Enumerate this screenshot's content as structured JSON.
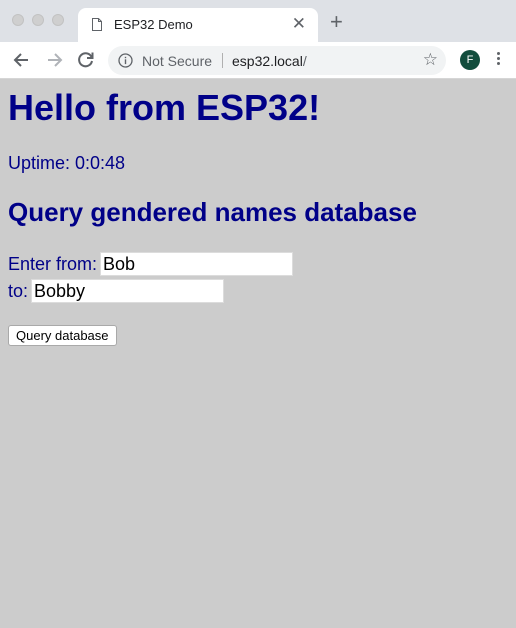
{
  "browser": {
    "tab_title": "ESP32 Demo",
    "tab_close": "✕",
    "new_tab": "+",
    "security_label": "Not Secure",
    "url_host": "esp32.local",
    "url_path": "/",
    "bookmark": "☆",
    "profile_initial": "F",
    "profile_color": "#124d3d"
  },
  "page": {
    "heading": "Hello from ESP32!",
    "uptime": "Uptime: 0:0:48",
    "subheading": "Query gendered names database",
    "from_label": "Enter from:",
    "from_value": "Bob",
    "to_label": "to:",
    "to_value": "Bobby",
    "button_label": "Query database",
    "text_color": "#000088",
    "background_color": "#cccccc"
  }
}
